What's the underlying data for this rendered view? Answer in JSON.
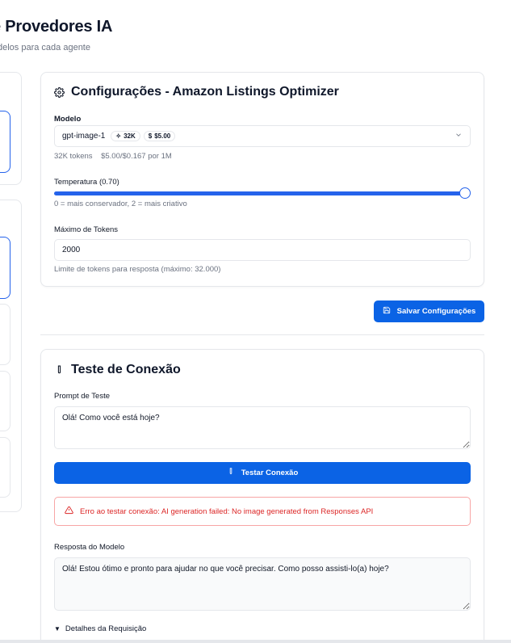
{
  "header": {
    "title": "e Provedores IA",
    "subtitle": "delos para cada agente"
  },
  "config": {
    "title": "Configurações - Amazon Listings Optimizer",
    "model_label": "Modelo",
    "model_value": "gpt-image-1",
    "model_context_badge": "32K",
    "model_price_badge": "$5.00",
    "model_info": "32K tokens    $5.00/$0.167 por 1M",
    "temperature_label": "Temperatura (0.70)",
    "temperature_value": 0.7,
    "temperature_range": [
      0,
      2
    ],
    "temperature_hint": "0 = mais conservador, 2 = mais criativo",
    "max_tokens_label": "Máximo de Tokens",
    "max_tokens_value": "2000",
    "max_tokens_hint": "Limite de tokens para resposta (máximo: 32.000)"
  },
  "save_button": "Salvar Configurações",
  "test": {
    "title": "Teste de Conexão",
    "prompt_label": "Prompt de Teste",
    "prompt_value": "Olá! Como você está hoje?",
    "test_button": "Testar Conexão",
    "error": "Erro ao testar conexão: AI generation failed: No image generated from Responses API",
    "response_label": "Resposta do Modelo",
    "response_value": "Olá! Estou ótimo e pronto para ajudar no que você precisar. Como posso assisti-lo(a) hoje?",
    "details_label": "Detalhes da Requisição"
  },
  "colors": {
    "accent": "#0b63e5",
    "error": "#dc2626",
    "border": "#e5e7eb"
  }
}
